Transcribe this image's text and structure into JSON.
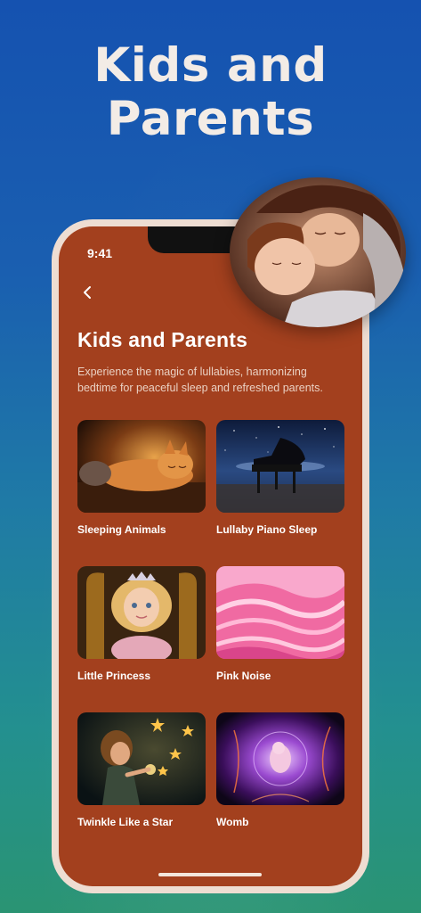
{
  "promo": {
    "headline_line1": "Kids and",
    "headline_line2": "Parents"
  },
  "status_bar": {
    "time": "9:41"
  },
  "nav": {
    "back_icon": "chevron-left-icon"
  },
  "page": {
    "title": "Kids and Parents",
    "description": "Experience the magic of lullabies, harmonizing bedtime for peaceful sleep and refreshed parents."
  },
  "items": [
    {
      "label": "Sleeping Animals"
    },
    {
      "label": "Lullaby Piano Sleep"
    },
    {
      "label": "Little Princess"
    },
    {
      "label": "Pink Noise"
    },
    {
      "label": "Twinkle Like a Star"
    },
    {
      "label": "Womb"
    }
  ],
  "colors": {
    "background_top": "#1552b0",
    "background_bottom": "#2a9473",
    "phone_frame": "#eeddd2",
    "screen": "#a3401e"
  }
}
